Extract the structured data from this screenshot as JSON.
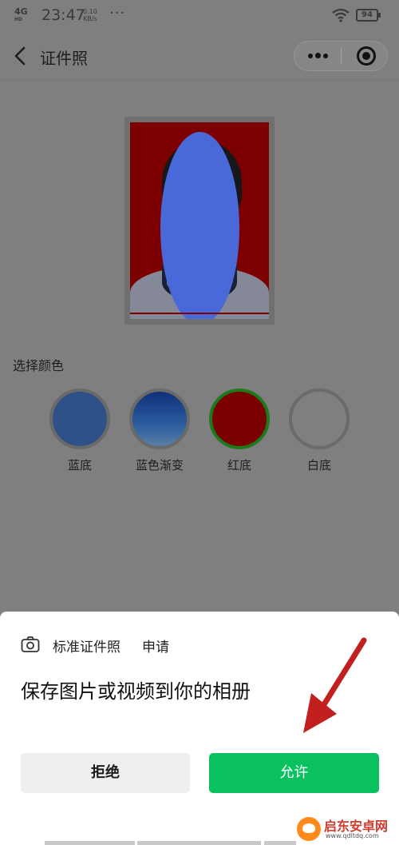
{
  "status_bar": {
    "network": "4G",
    "network_sub": "HD",
    "time": "23:47",
    "speed_value": "0.10",
    "speed_unit": "KB/s",
    "more": "···",
    "battery": "94"
  },
  "navbar": {
    "title": "证件照"
  },
  "photo": {
    "background_color": "#7d0000"
  },
  "color_picker": {
    "label": "选择颜色",
    "options": [
      {
        "label": "蓝底",
        "color": "#2e5188",
        "selected": false
      },
      {
        "label": "蓝色渐变",
        "color": "#1a4a8a",
        "selected": false
      },
      {
        "label": "红底",
        "color": "#7a0000",
        "selected": true
      },
      {
        "label": "白底",
        "color": "#7f7f7f",
        "selected": false
      }
    ]
  },
  "permission_sheet": {
    "app_name": "标准证件照",
    "action": "申请",
    "prompt": "保存图片或视频到你的相册",
    "deny_label": "拒绝",
    "allow_label": "允许",
    "allow_color": "#0ac160"
  },
  "watermark": {
    "title": "启东安卓网",
    "url": "www.qdltdq.com"
  }
}
